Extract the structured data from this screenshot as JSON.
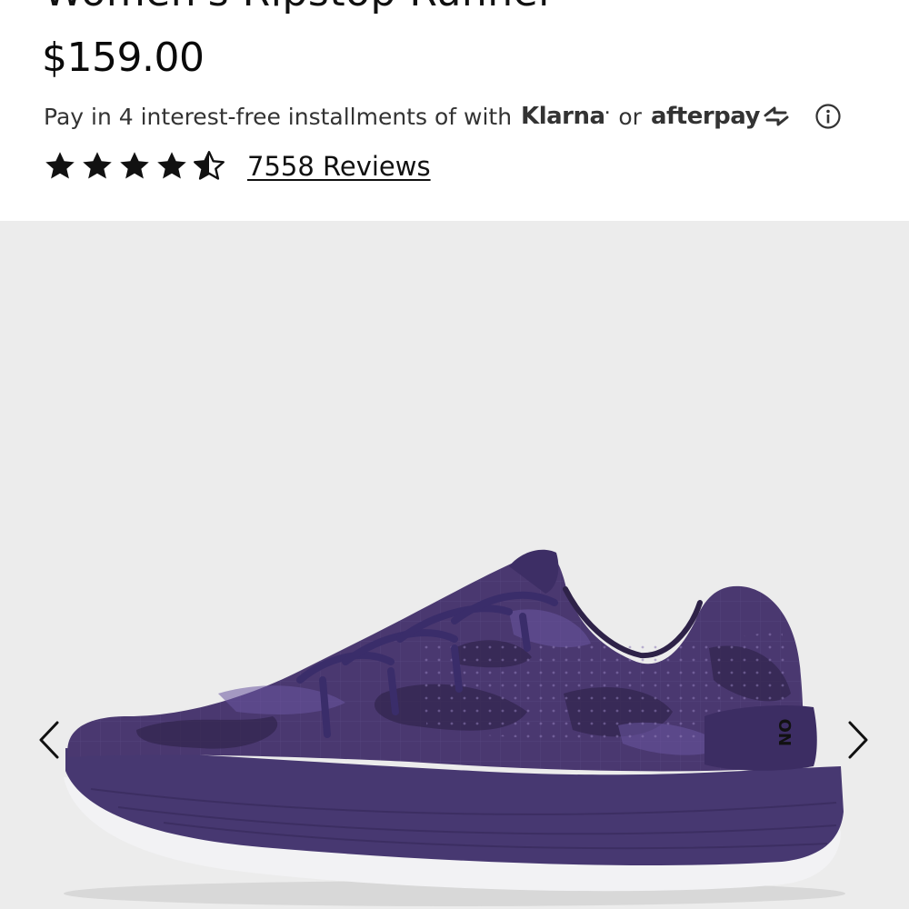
{
  "product": {
    "title": "Women's Ripstop Runner",
    "price": "$159.00"
  },
  "payment": {
    "text": "Pay in 4 interest-free installments of with",
    "klarna": "Klarna",
    "klarna_mark": ".",
    "or": "or",
    "afterpay": "afterpay"
  },
  "rating": {
    "stars": 4.5,
    "reviews_label": "7558 Reviews"
  },
  "gallery": {
    "brand_stamp": "NO",
    "bg_color": "#ececec",
    "shoe_color": "#4a3870"
  },
  "icons": {
    "info": "info-icon",
    "prev": "chevron-left-icon",
    "next": "chevron-right-icon"
  }
}
